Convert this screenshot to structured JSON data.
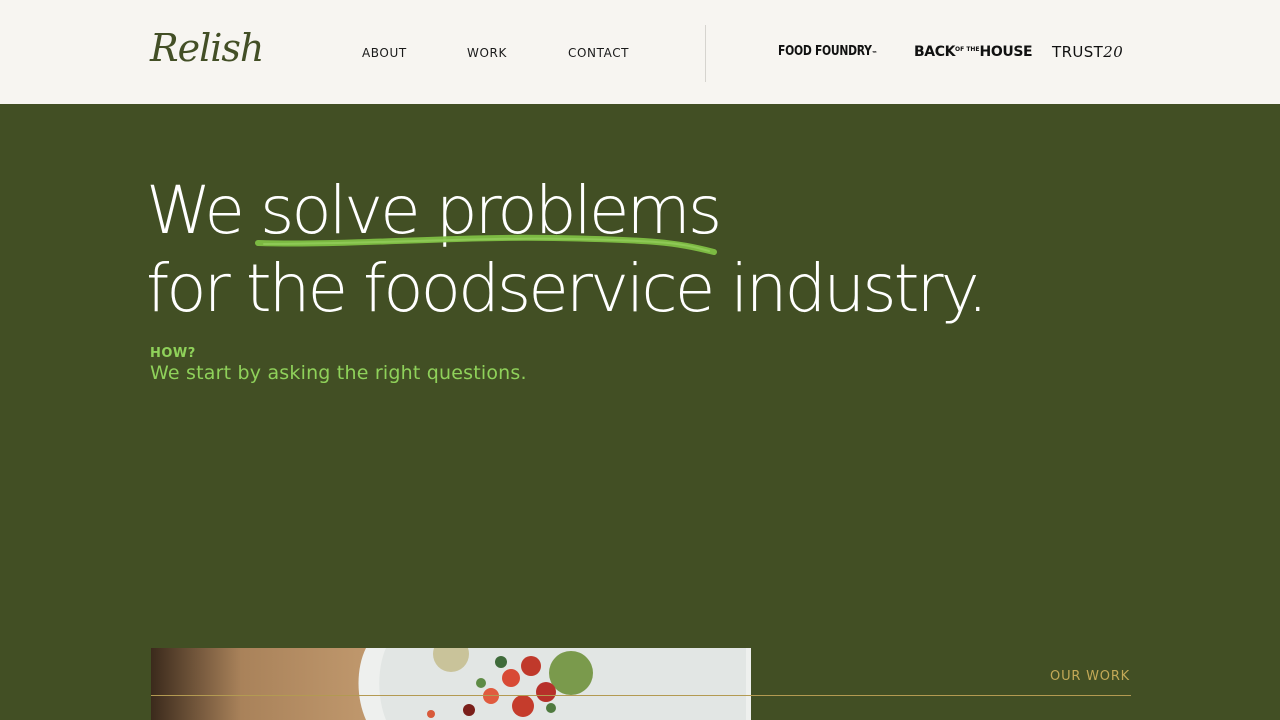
{
  "header": {
    "logo": "Relish",
    "nav": [
      {
        "label": "ABOUT"
      },
      {
        "label": "WORK"
      },
      {
        "label": "CONTACT"
      }
    ],
    "brands": [
      {
        "name": "FOOD FOUNDRY",
        "mark": "™"
      },
      {
        "part1": "BACK",
        "of": "OF THE",
        "part2": "HOUSE"
      },
      {
        "text": "TRUST",
        "num": "20"
      }
    ]
  },
  "hero": {
    "line1_prefix": "We ",
    "line1_highlight": "solve problems",
    "line2": "for the foodservice industry.",
    "how_label": "HOW?",
    "subtitle": "We start by asking the right questions."
  },
  "work": {
    "link": "OUR WORK"
  },
  "colors": {
    "header_bg": "#f7f5f1",
    "hero_bg": "#424f24",
    "accent_green": "#8fd15a",
    "gold": "#c3a957"
  }
}
